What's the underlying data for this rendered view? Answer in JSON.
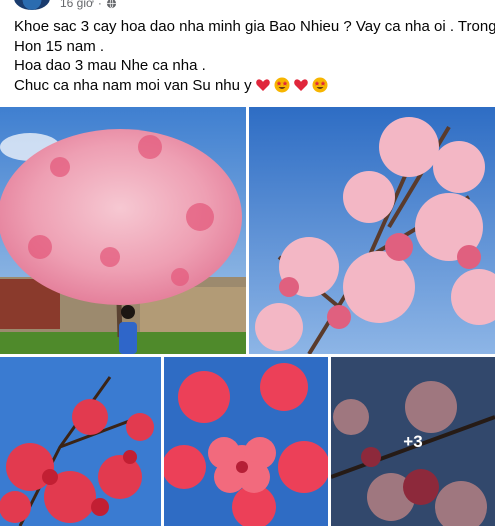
{
  "post": {
    "time_label": "16 giờ",
    "privacy_icon": "globe-icon",
    "caption_lines": [
      "Khoe sac 3 cay hoa dao nha minh gia Bao Nhieu ? Vay ca nha oi . Trong",
      "Hon 15 nam .",
      "Hoa dao 3 mau Nhe ca nha .",
      "Chuc ca nha nam moi van Su nhu y"
    ],
    "caption_emojis": [
      "red-heart",
      "star-struck",
      "red-heart",
      "star-struck"
    ]
  },
  "photos": [
    {
      "description_name": "tree-with-woman-photo"
    },
    {
      "description_name": "pink-blossom-branches-photo"
    },
    {
      "description_name": "red-blossom-branches-photo"
    },
    {
      "description_name": "red-blossom-closeup-photo"
    },
    {
      "description_name": "pink-blossom-closeup-photo",
      "more_count": "+3"
    }
  ]
}
